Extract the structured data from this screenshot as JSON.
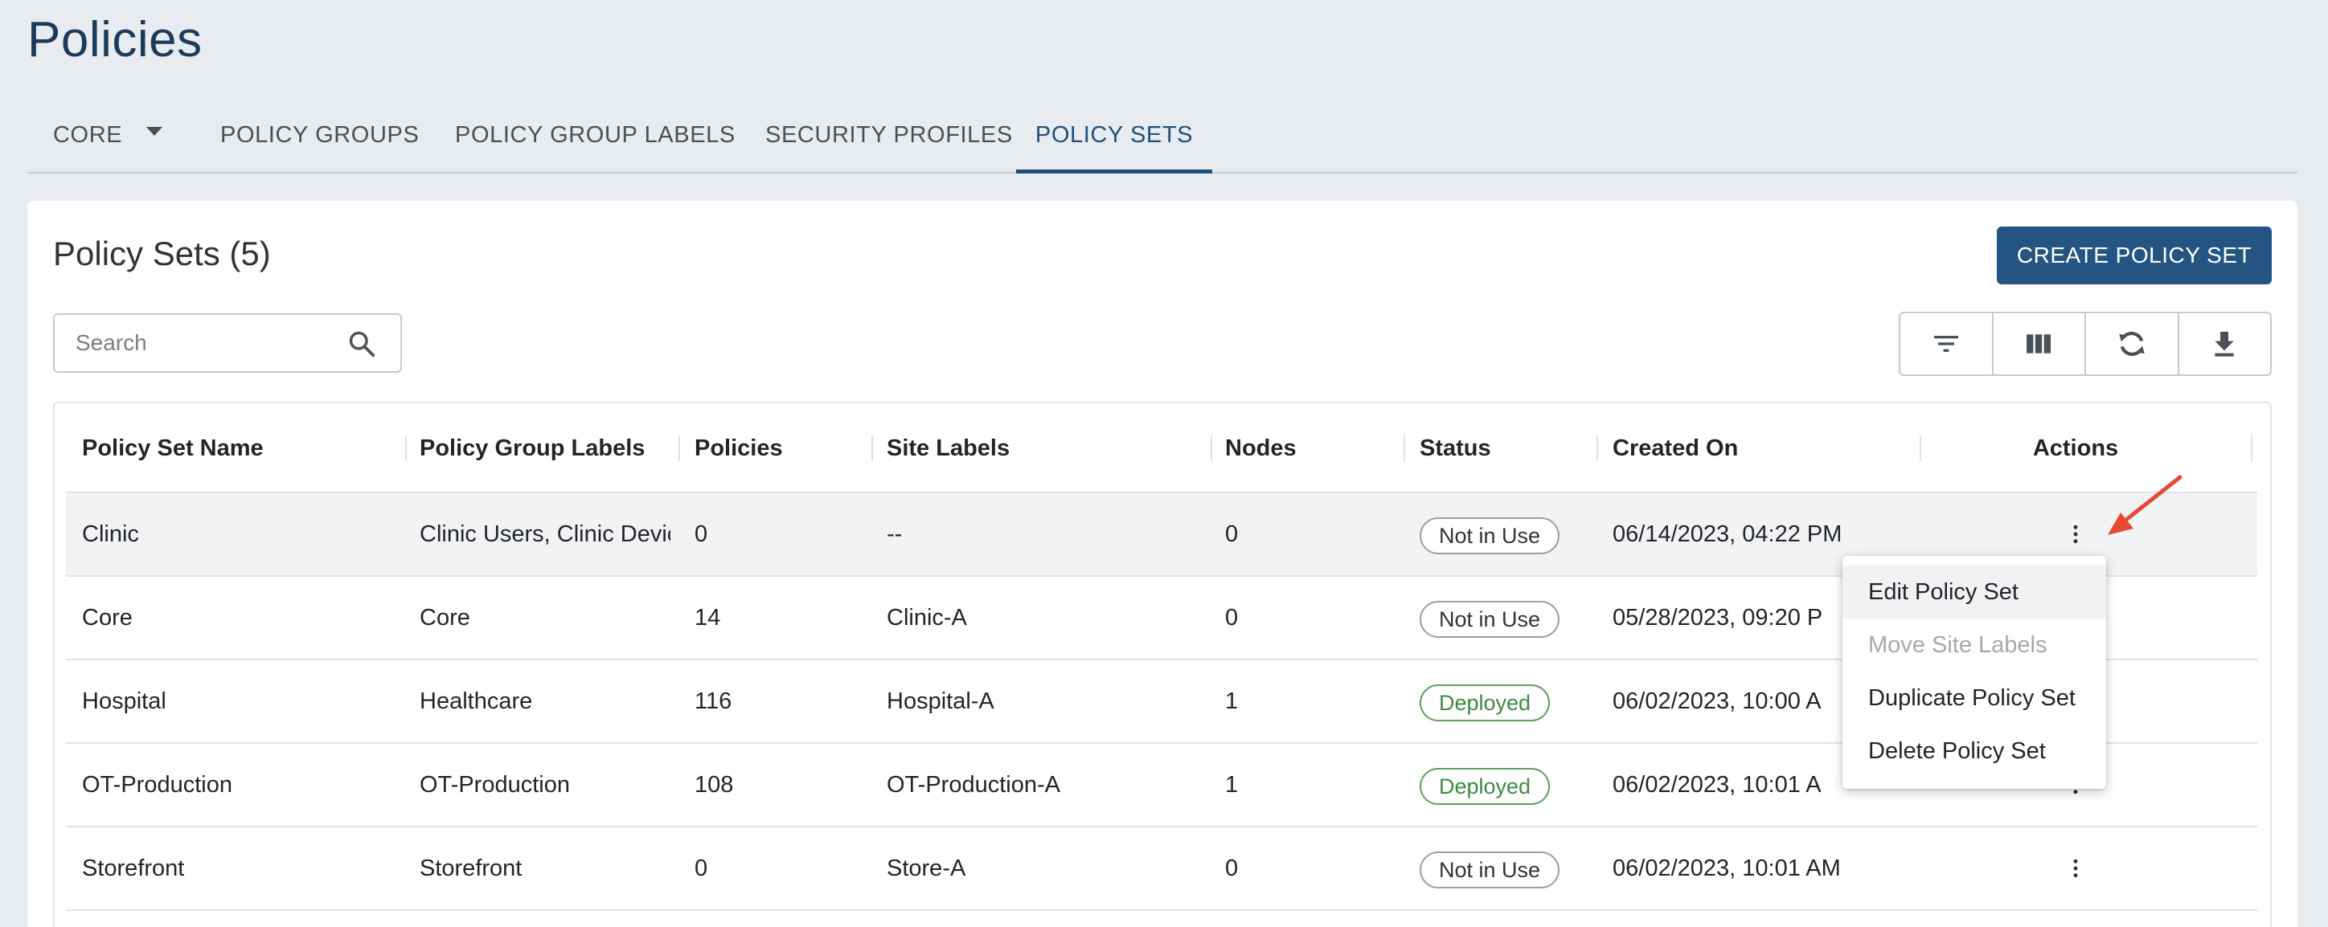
{
  "page": {
    "title": "Policies"
  },
  "tabs": [
    {
      "label": "CORE",
      "active": false
    },
    {
      "label": "POLICY GROUPS",
      "active": false
    },
    {
      "label": "POLICY GROUP LABELS",
      "active": false
    },
    {
      "label": "SECURITY PROFILES",
      "active": false
    },
    {
      "label": "POLICY SETS",
      "active": true
    }
  ],
  "card": {
    "title": "Policy Sets (5)",
    "create_button": "CREATE POLICY SET",
    "search_placeholder": "Search"
  },
  "toolbar": {
    "icons": [
      "filter-icon",
      "columns-icon",
      "refresh-icon",
      "download-icon"
    ]
  },
  "table": {
    "headers": [
      "Policy Set Name",
      "Policy Group Labels",
      "Policies",
      "Site Labels",
      "Nodes",
      "Status",
      "Created On",
      "Actions"
    ],
    "rows": [
      {
        "name": "Clinic",
        "group_labels": "Clinic Users, Clinic Devic",
        "policies": "0",
        "site_labels": "--",
        "nodes": "0",
        "status": "Not in Use",
        "created_on": "06/14/2023, 04:22 PM"
      },
      {
        "name": "Core",
        "group_labels": "Core",
        "policies": "14",
        "site_labels": "Clinic-A",
        "nodes": "0",
        "status": "Not in Use",
        "created_on": "05/28/2023, 09:20 P"
      },
      {
        "name": "Hospital",
        "group_labels": "Healthcare",
        "policies": "116",
        "site_labels": "Hospital-A",
        "nodes": "1",
        "status": "Deployed",
        "created_on": "06/02/2023, 10:00 A"
      },
      {
        "name": "OT-Production",
        "group_labels": "OT-Production",
        "policies": "108",
        "site_labels": "OT-Production-A",
        "nodes": "1",
        "status": "Deployed",
        "created_on": "06/02/2023, 10:01 A"
      },
      {
        "name": "Storefront",
        "group_labels": "Storefront",
        "policies": "0",
        "site_labels": "Store-A",
        "nodes": "0",
        "status": "Not in Use",
        "created_on": "06/02/2023, 10:01 AM"
      }
    ]
  },
  "actions_menu": {
    "items": [
      {
        "label": "Edit Policy Set",
        "state": "highlighted"
      },
      {
        "label": "Move Site Labels",
        "state": "disabled"
      },
      {
        "label": "Duplicate Policy Set",
        "state": "normal"
      },
      {
        "label": "Delete Policy Set",
        "state": "normal"
      }
    ]
  },
  "colors": {
    "accent": "#245582",
    "tab_active": "#1f4f7b",
    "deployed": "#3c8a3c",
    "annotation_arrow": "#e5492f"
  }
}
